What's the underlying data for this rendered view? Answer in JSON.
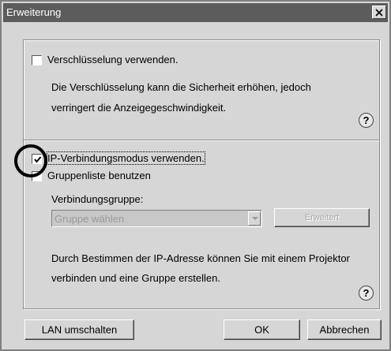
{
  "window": {
    "title": "Erweiterung"
  },
  "encryption": {
    "checkbox_label": "Verschlüsselung verwenden.",
    "checked": false,
    "description_line1": "Die Verschlüsselung kann die Sicherheit erhöhen, jedoch",
    "description_line2": "verringert die Anzeigegeschwindigkeit."
  },
  "connection": {
    "ip_mode_label": "IP-Verbindungsmodus verwenden.",
    "ip_mode_checked": true,
    "group_list_label": "Gruppenliste benutzen",
    "group_list_checked": false,
    "group_field_label": "Verbindungsgruppe:",
    "group_select_value": "Gruppe wählen",
    "advanced_button": "Erweitert",
    "description_line1": "Durch Bestimmen der IP-Adresse können Sie mit einem Projektor",
    "description_line2": "verbinden und eine Gruppe erstellen."
  },
  "help": {
    "glyph": "?"
  },
  "footer": {
    "lan_button": "LAN umschalten",
    "ok_button": "OK",
    "cancel_button": "Abbrechen"
  },
  "icons": {
    "close": "close-icon",
    "help": "help-icon",
    "dropdown": "chevron-down-icon",
    "check": "check-icon"
  },
  "colors": {
    "titlebar": "#5c5c5c",
    "dialog_bg": "#d6d6d6",
    "disabled_text": "#9a9a9a"
  }
}
